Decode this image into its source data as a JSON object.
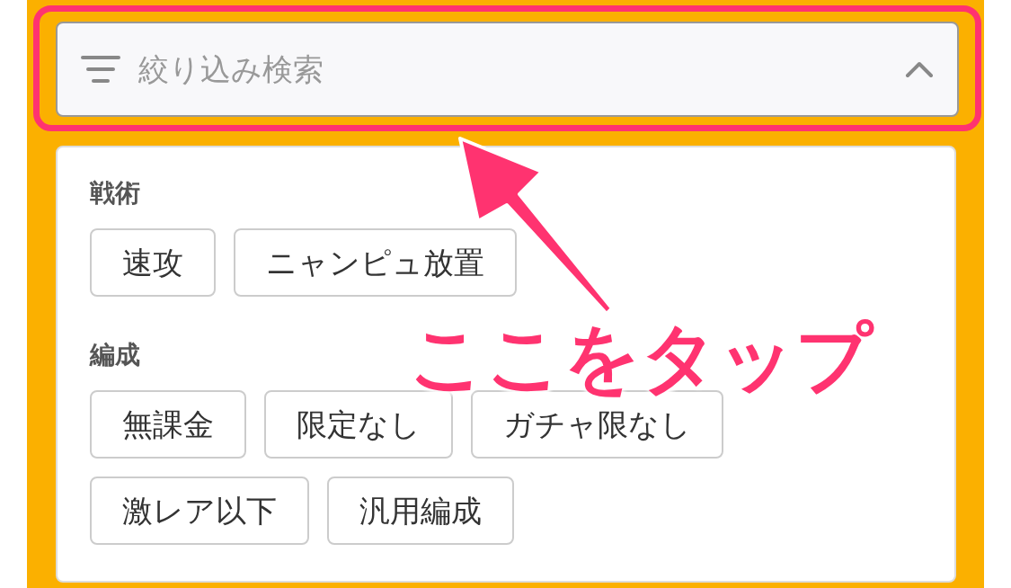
{
  "search": {
    "placeholder": "絞り込み検索",
    "expanded": true,
    "highlighted": true
  },
  "sections": [
    {
      "title": "戦術",
      "tags": [
        {
          "label": "速攻"
        },
        {
          "label": "ニャンピュ放置"
        }
      ]
    },
    {
      "title": "編成",
      "tags": [
        {
          "label": "無課金"
        },
        {
          "label": "限定なし"
        },
        {
          "label": "ガチャ限なし"
        },
        {
          "label": "激レア以下"
        },
        {
          "label": "汎用編成"
        }
      ]
    }
  ],
  "annotation": {
    "text": "ここをタップ"
  }
}
